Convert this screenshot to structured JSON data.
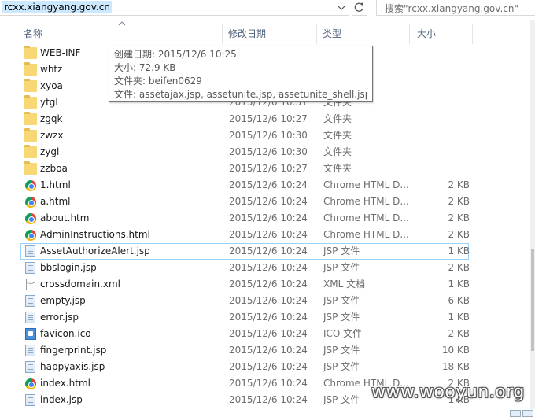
{
  "address_bar": {
    "path": "rcxx.xiangyang.gov.cn"
  },
  "search": {
    "placeholder": "搜索\"rcxx.xiangyang.gov.cn\""
  },
  "columns": {
    "name": "名称",
    "date": "修改日期",
    "type": "类型",
    "size": "大小"
  },
  "tooltip": {
    "created": "创建日期: 2015/12/6 10:25",
    "size": "大小: 72.9 KB",
    "folders": "文件夹: beifen0629",
    "files": "文件: assetajax.jsp, assetunite.jsp, assetunite_shell.jsp, ..."
  },
  "files": [
    {
      "name": "WEB-INF",
      "date": "",
      "type": "",
      "size": "",
      "icon": "folder-icon"
    },
    {
      "name": "whtz",
      "date": "",
      "type": "",
      "size": "",
      "icon": "folder-icon"
    },
    {
      "name": "xyoa",
      "date": "",
      "type": "",
      "size": "",
      "icon": "folder-icon"
    },
    {
      "name": "ytgl",
      "date": "2015/12/6 10:31",
      "type": "文件夹",
      "size": "",
      "icon": "folder-icon"
    },
    {
      "name": "zgqk",
      "date": "2015/12/6 10:27",
      "type": "文件夹",
      "size": "",
      "icon": "folder-icon"
    },
    {
      "name": "zwzx",
      "date": "2015/12/6 10:30",
      "type": "文件夹",
      "size": "",
      "icon": "folder-icon"
    },
    {
      "name": "zygl",
      "date": "2015/12/6 10:30",
      "type": "文件夹",
      "size": "",
      "icon": "folder-icon"
    },
    {
      "name": "zzboa",
      "date": "2015/12/6 10:27",
      "type": "文件夹",
      "size": "",
      "icon": "folder-icon"
    },
    {
      "name": "1.html",
      "date": "2015/12/6 10:24",
      "type": "Chrome HTML D...",
      "size": "2 KB",
      "icon": "chrome-html-icon"
    },
    {
      "name": "a.html",
      "date": "2015/12/6 10:24",
      "type": "Chrome HTML D...",
      "size": "2 KB",
      "icon": "chrome-html-icon"
    },
    {
      "name": "about.htm",
      "date": "2015/12/6 10:24",
      "type": "Chrome HTML D...",
      "size": "2 KB",
      "icon": "chrome-html-icon"
    },
    {
      "name": "AdminInstructions.html",
      "date": "2015/12/6 10:24",
      "type": "Chrome HTML D...",
      "size": "2 KB",
      "icon": "chrome-html-icon"
    },
    {
      "name": "AssetAuthorizeAlert.jsp",
      "date": "2015/12/6 10:24",
      "type": "JSP 文件",
      "size": "1 KB",
      "icon": "jsp-file-icon",
      "selected": true
    },
    {
      "name": "bbslogin.jsp",
      "date": "2015/12/6 10:24",
      "type": "JSP 文件",
      "size": "2 KB",
      "icon": "jsp-file-icon"
    },
    {
      "name": "crossdomain.xml",
      "date": "2015/12/6 10:24",
      "type": "XML 文档",
      "size": "1 KB",
      "icon": "xml-file-icon"
    },
    {
      "name": "empty.jsp",
      "date": "2015/12/6 10:24",
      "type": "JSP 文件",
      "size": "6 KB",
      "icon": "jsp-file-icon"
    },
    {
      "name": "error.jsp",
      "date": "2015/12/6 10:24",
      "type": "JSP 文件",
      "size": "1 KB",
      "icon": "jsp-file-icon"
    },
    {
      "name": "favicon.ico",
      "date": "2015/12/6 10:24",
      "type": "ICO 文件",
      "size": "2 KB",
      "icon": "ico-file-icon"
    },
    {
      "name": "fingerprint.jsp",
      "date": "2015/12/6 10:24",
      "type": "JSP 文件",
      "size": "10 KB",
      "icon": "jsp-file-icon"
    },
    {
      "name": "happyaxis.jsp",
      "date": "2015/12/6 10:24",
      "type": "JSP 文件",
      "size": "18 KB",
      "icon": "jsp-file-icon"
    },
    {
      "name": "index.html",
      "date": "2015/12/6 10:24",
      "type": "Chrome HTML D...",
      "size": "2 KB",
      "icon": "chrome-html-icon"
    },
    {
      "name": "index.jsp",
      "date": "2015/12/6 10:24",
      "type": "JSP 文件",
      "size": "1 KB",
      "icon": "jsp-file-icon"
    }
  ],
  "watermark": "www.wooyun.org"
}
